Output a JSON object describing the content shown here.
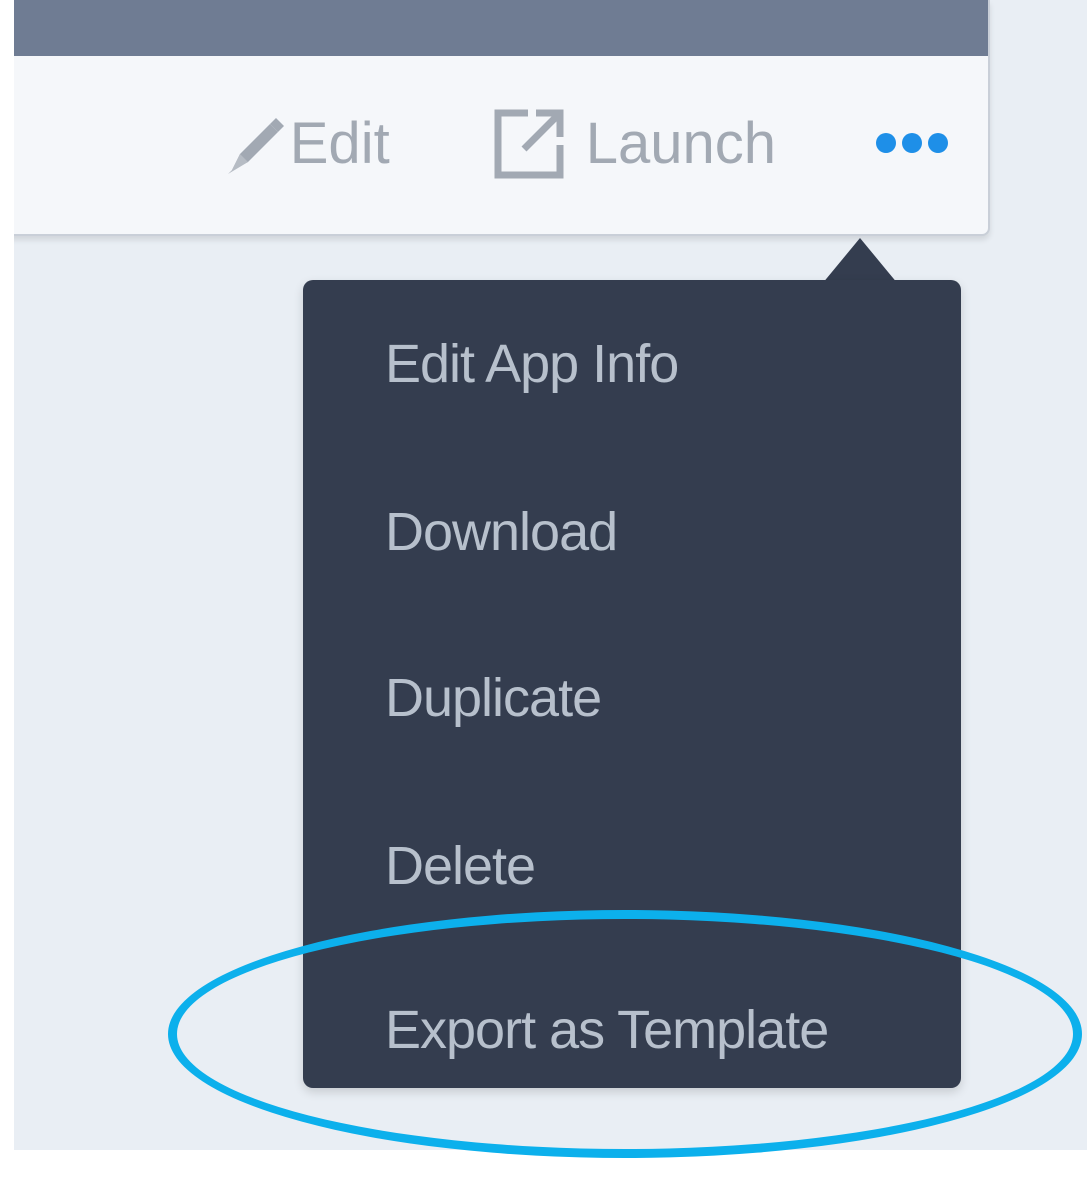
{
  "toolbar": {
    "edit_label": "Edit",
    "launch_label": "Launch",
    "more_icon": "ellipsis-icon"
  },
  "menu": {
    "items": [
      {
        "label": "Edit App Info"
      },
      {
        "label": "Download"
      },
      {
        "label": "Duplicate"
      },
      {
        "label": "Delete"
      },
      {
        "label": "Export as Template"
      }
    ]
  },
  "annotation": {
    "highlighted_item": "Export as Template",
    "color": "#0cb0ec"
  },
  "colors": {
    "header_strip": "#6f7c93",
    "menu_background": "#343d4f",
    "menu_text": "#b7c0cc",
    "accent": "#1e8fe8"
  },
  "icons": {
    "edit": "pencil-icon",
    "launch": "external-link-icon"
  }
}
